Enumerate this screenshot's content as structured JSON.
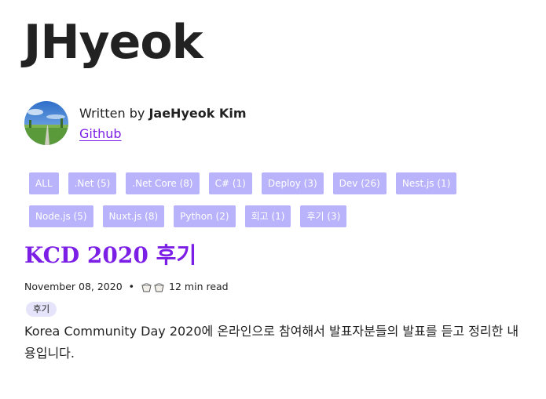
{
  "site": {
    "title": "JHyeok"
  },
  "bio": {
    "written_by": "Written by ",
    "author": "JaeHyeok Kim",
    "github_label": "Github"
  },
  "tags": [
    {
      "label": "ALL"
    },
    {
      "label": ".Net (5)"
    },
    {
      "label": ".Net Core (8)"
    },
    {
      "label": "C# (1)"
    },
    {
      "label": "Deploy (3)"
    },
    {
      "label": "Dev (26)"
    },
    {
      "label": "Nest.js (1)"
    },
    {
      "label": "Node.js (5)"
    },
    {
      "label": "Nuxt.js (8)"
    },
    {
      "label": "Python (2)"
    },
    {
      "label": "회고 (1)"
    },
    {
      "label": "후기 (3)"
    }
  ],
  "post": {
    "title": "KCD 2020 후기",
    "date": "November 08, 2020",
    "separator": "•",
    "read_time": "12 min read",
    "tag": "후기",
    "description": "Korea Community Day 2020에 온라인으로 참여해서 발표자분들의 발표를 듣고 정리한 내용입니다."
  },
  "colors": {
    "accent": "#7c1fe6",
    "tag_bg": "#b8b3fb",
    "post_tag_bg": "#e6e4fa"
  }
}
